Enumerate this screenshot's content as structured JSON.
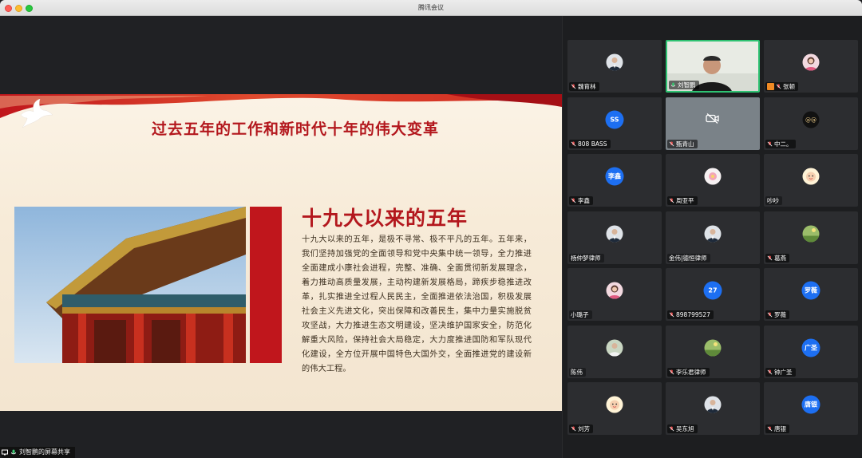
{
  "window": {
    "title": "腾讯会议"
  },
  "slide": {
    "title": "过去五年的工作和新时代十年的伟大变革",
    "heading": "十九大以来的五年",
    "body": "十九大以来的五年，是极不寻常、极不平凡的五年。五年来，我们坚持加强党的全面领导和党中央集中统一领导，全力推进全面建成小康社会进程，完整、准确、全面贯彻新发展理念，着力推动高质量发展，主动构建新发展格局，蹄疾步稳推进改革，扎实推进全过程人民民主，全面推进依法治国，积极发展社会主义先进文化，突出保障和改善民生，集中力量实施脱贫攻坚战，大力推进生态文明建设，坚决维护国家安全，防范化解重大风险，保持社会大局稳定，大力度推进国防和军队现代化建设，全方位开展中国特色大国外交，全面推进党的建设新的伟大工程。"
  },
  "presenter": {
    "label": "刘智鹏的屏幕共享"
  },
  "participants": [
    {
      "name": "魏育林",
      "kind": "photo",
      "icon": "man-suit-avatar",
      "mic": "muted"
    },
    {
      "name": "刘智鹏",
      "kind": "video",
      "icon": "live-video",
      "mic": "active"
    },
    {
      "name": "张顿",
      "kind": "photo",
      "icon": "woman-avatar",
      "mic": "muted",
      "host": true
    },
    {
      "name": "808 BASS",
      "kind": "initials",
      "initials": "SS",
      "mic": "muted"
    },
    {
      "name": "甄青山",
      "kind": "camera-off",
      "icon": "camera-off-icon",
      "mic": "muted"
    },
    {
      "name": "中二。",
      "kind": "photo",
      "icon": "logo-avatar",
      "mic": "muted"
    },
    {
      "name": "李鑫",
      "kind": "initials",
      "initials": "李鑫",
      "mic": "muted"
    },
    {
      "name": "周亚平",
      "kind": "photo",
      "icon": "flower-avatar",
      "mic": "muted"
    },
    {
      "name": "吵吵",
      "kind": "photo",
      "icon": "cartoon-avatar",
      "mic": "none"
    },
    {
      "name": "杨仲梦律师",
      "kind": "photo",
      "icon": "man-suit-avatar",
      "mic": "none"
    },
    {
      "name": "金伟|德恒律师",
      "kind": "photo",
      "icon": "man-suit-avatar",
      "mic": "none"
    },
    {
      "name": "葛燕",
      "kind": "photo",
      "icon": "landscape-avatar",
      "mic": "muted"
    },
    {
      "name": "小璐子",
      "kind": "photo",
      "icon": "woman-avatar",
      "mic": "none"
    },
    {
      "name": "898799527",
      "kind": "initials",
      "initials": "27",
      "mic": "muted"
    },
    {
      "name": "罗薇",
      "kind": "initials",
      "initials": "罗薇",
      "mic": "muted"
    },
    {
      "name": "陈伟",
      "kind": "photo",
      "icon": "man-avatar",
      "mic": "none"
    },
    {
      "name": "李乐君律师",
      "kind": "photo",
      "icon": "landscape-avatar",
      "mic": "muted"
    },
    {
      "name": "钟广圣",
      "kind": "initials",
      "initials": "广圣",
      "mic": "muted"
    },
    {
      "name": "刘芳",
      "kind": "photo",
      "icon": "cartoon-avatar",
      "mic": "muted"
    },
    {
      "name": "吴东旭",
      "kind": "photo",
      "icon": "man-suit-avatar",
      "mic": "muted"
    },
    {
      "name": "唐银",
      "kind": "initials",
      "initials": "唐银",
      "mic": "muted"
    }
  ]
}
